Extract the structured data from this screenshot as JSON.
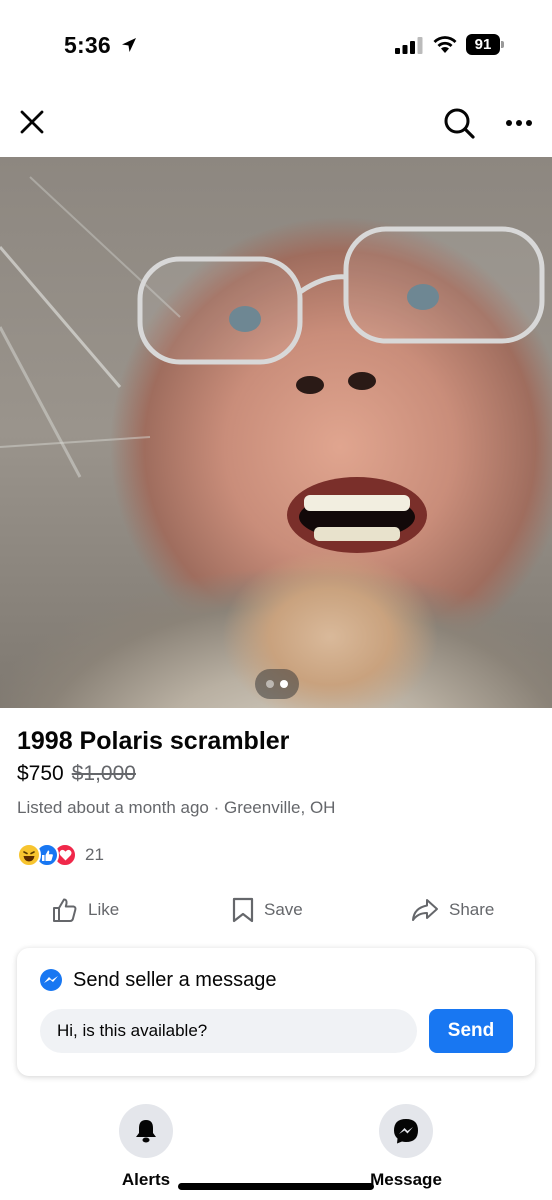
{
  "status_bar": {
    "time": "5:36",
    "battery": "91"
  },
  "nav": {
    "close_icon": "close-icon",
    "search_icon": "search-icon",
    "more_icon": "more-horizontal-icon"
  },
  "photo": {
    "page_count": 2,
    "current_page": 2
  },
  "listing": {
    "title": "1998 Polaris scrambler",
    "price": "$750",
    "original_price": "$1,000",
    "meta": "Listed about a month ago · Greenville, OH",
    "reaction_count": "21"
  },
  "actions": {
    "like_label": "Like",
    "save_label": "Save",
    "share_label": "Share"
  },
  "message_card": {
    "header": "Send seller a message",
    "input_value": "Hi, is this available?",
    "send_label": "Send"
  },
  "bottom_bar": {
    "alerts_label": "Alerts",
    "message_label": "Message"
  },
  "colors": {
    "accent": "#1877f2",
    "secondary_text": "#65676b",
    "input_bg": "#f0f2f5"
  }
}
